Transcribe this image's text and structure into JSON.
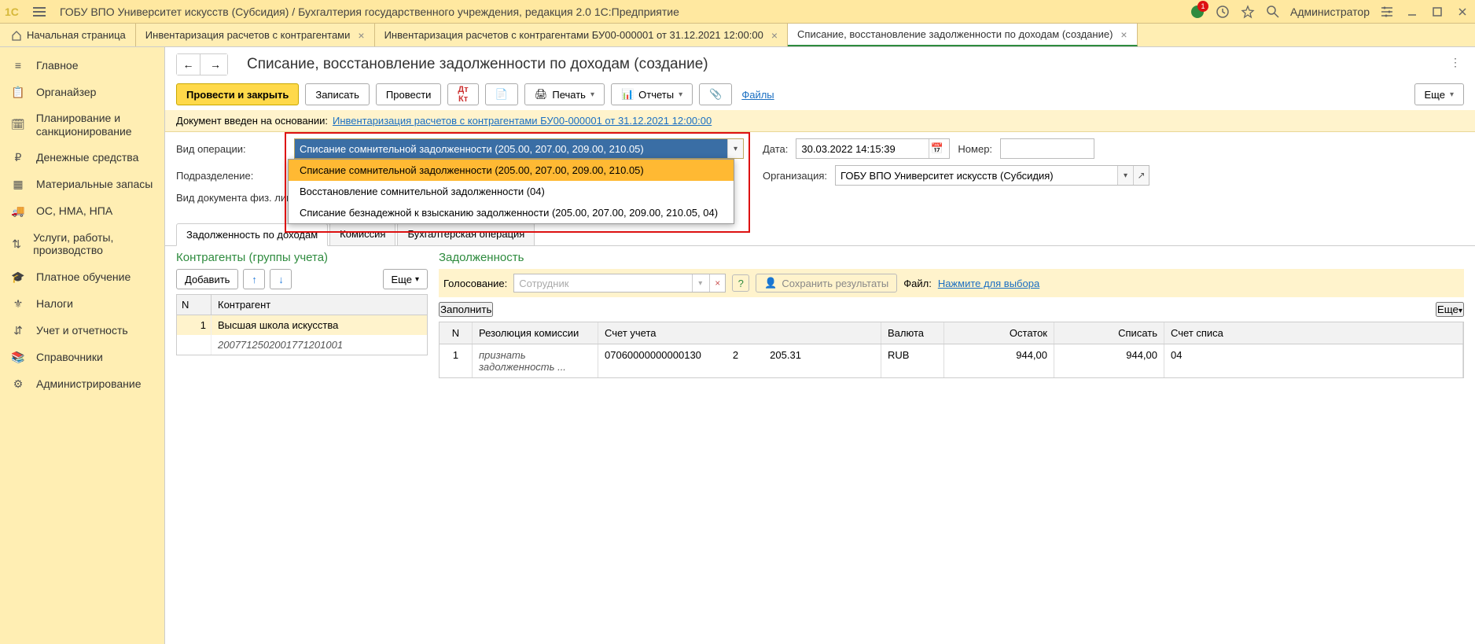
{
  "app_title": "ГОБУ ВПО Университет искусств (Субсидия) / Бухгалтерия государственного учреждения, редакция 2.0 1С:Предприятие",
  "user": "Администратор",
  "badge_count": "1",
  "tabs": {
    "home": "Начальная страница",
    "t1": "Инвентаризация расчетов с контрагентами",
    "t2": "Инвентаризация расчетов с контрагентами БУ00-000001 от 31.12.2021 12:00:00",
    "t3": "Списание, восстановление задолженности по доходам (создание)"
  },
  "sidebar": [
    "Главное",
    "Органайзер",
    "Планирование и санкционирование",
    "Денежные средства",
    "Материальные запасы",
    "ОС, НМА, НПА",
    "Услуги, работы, производство",
    "Платное обучение",
    "Налоги",
    "Учет и отчетность",
    "Справочники",
    "Администрирование"
  ],
  "page_title": "Списание, восстановление задолженности по доходам (создание)",
  "toolbar": {
    "post_close": "Провести и закрыть",
    "write": "Записать",
    "post": "Провести",
    "print": "Печать",
    "reports": "Отчеты",
    "files": "Файлы",
    "more": "Еще"
  },
  "docinfo": {
    "label": "Документ введен на основании:",
    "link": "Инвентаризация расчетов с контрагентами БУ00-000001 от 31.12.2021 12:00:00"
  },
  "form": {
    "op_label": "Вид операции:",
    "op_value": "Списание сомнительной задолженности (205.00, 207.00, 209.00, 210.05)",
    "op_options": [
      "Списание сомнительной задолженности (205.00, 207.00, 209.00, 210.05)",
      "Восстановление сомнительной задолженности (04)",
      "Списание безнадежной к взысканию задолженности (205.00, 207.00, 209.00, 210.05, 04)"
    ],
    "date_label": "Дата:",
    "date_value": "30.03.2022 14:15:39",
    "num_label": "Номер:",
    "subdiv_label": "Подразделение:",
    "org_label": "Организация:",
    "org_value": "ГОБУ ВПО Университет искусств (Субсидия)",
    "phys_label": "Вид документа физ. лиц:"
  },
  "doctabs": {
    "t1": "Задолженность по доходам",
    "t2": "Комиссия",
    "t3": "Бухгалтерская операция"
  },
  "left": {
    "title": "Контрагенты (группы учета)",
    "add": "Добавить",
    "more": "Еще",
    "head_n": "N",
    "head_c": "Контрагент",
    "row_n": "1",
    "row_c": "Высшая школа искусства",
    "row_sub": "2007712502001771201001"
  },
  "right": {
    "title": "Задолженность",
    "vote_label": "Голосование:",
    "vote_placeholder": "Сотрудник",
    "save_res": "Сохранить результаты",
    "file_label": "Файл:",
    "file_link": "Нажмите для выбора",
    "fill": "Заполнить",
    "more": "Еще",
    "head": {
      "n": "N",
      "res": "Резолюция комиссии",
      "acc": "Счет учета",
      "cur": "Валюта",
      "bal": "Остаток",
      "wr": "Списать",
      "sacc": "Счет списа"
    },
    "row": {
      "n": "1",
      "res": "признать задолженность ...",
      "acc1": "07060000000000130",
      "acc2": "2",
      "acc3": "205.31",
      "cur": "RUB",
      "bal": "944,00",
      "wr": "944,00",
      "sacc": "04"
    }
  }
}
